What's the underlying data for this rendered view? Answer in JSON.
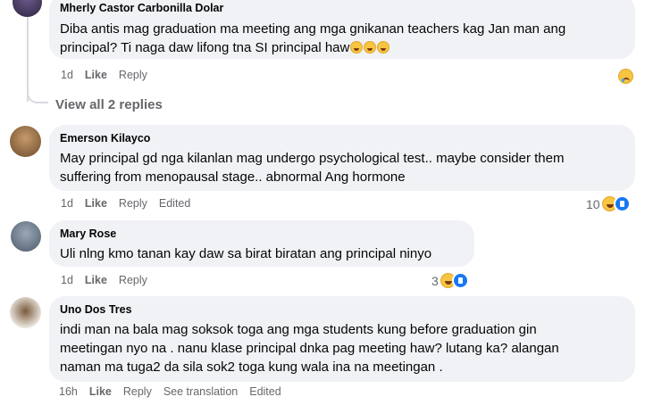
{
  "comments": [
    {
      "author": "Mherly Castor Carbonilla Dolar",
      "lines": [
        "Diba antis mag graduation ma meeting ang mga gnikanan teachers kag Jan man ang",
        "principal? Ti naga daw lifong tna SI principal haw"
      ],
      "time": "1d",
      "like": "Like",
      "reply": "Reply"
    },
    {
      "author": "Emerson Kilayco",
      "lines": [
        "May principal gd nga kilanlan mag undergo psychological test.. maybe consider them",
        "suffering from menopausal stage.. abnormal Ang hormone"
      ],
      "time": "1d",
      "like": "Like",
      "reply": "Reply",
      "edited": "Edited",
      "reactions": "10"
    },
    {
      "author": "Mary Rose",
      "lines": [
        "Uli nlng kmo tanan kay daw sa birat biratan ang principal ninyo"
      ],
      "time": "1d",
      "like": "Like",
      "reply": "Reply",
      "reactions": "3"
    },
    {
      "author": "Uno Dos Tres",
      "lines": [
        "indi man na bala mag soksok toga ang mga students kung before graduation gin",
        "meetingan nyo na . nanu klase principal dnka pag meeting haw? lutang ka? alangan",
        "naman ma tuga2 da sila sok2 toga kung wala ina na meetingan ."
      ],
      "time": "16h",
      "like": "Like",
      "reply": "Reply",
      "see_translation": "See translation",
      "edited": "Edited"
    }
  ],
  "view_replies": "View all 2 replies",
  "icons": {
    "haha": "haha-reaction-icon",
    "like": "like-reaction-icon",
    "sad": "sad-reaction-icon"
  },
  "colors": {
    "bubble": "#f0f2f5",
    "meta": "#65676b",
    "like_blue": "#1877f2"
  }
}
